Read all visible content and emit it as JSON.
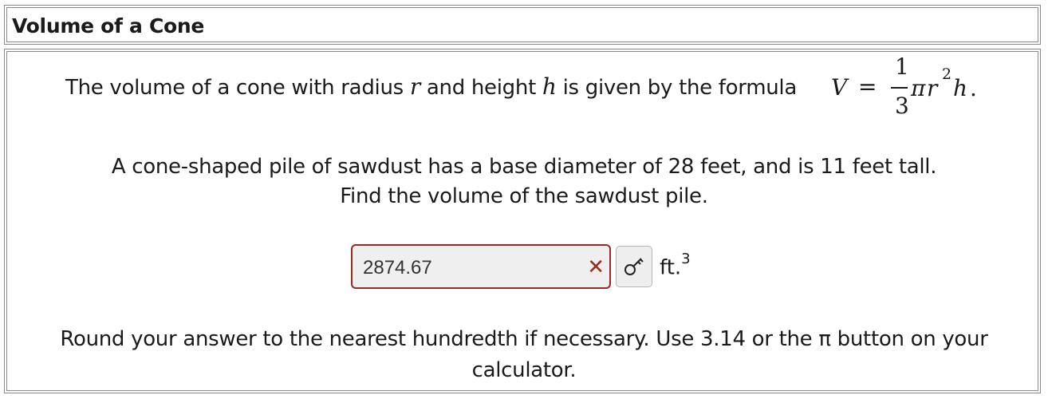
{
  "title": "Volume of a Cone",
  "problem": {
    "formula_intro": {
      "part1": "The volume of a cone with radius ",
      "var_r": "r",
      "part2": " and height ",
      "var_h": "h",
      "part3": " is given by the formula "
    },
    "formula": {
      "lhs": "V",
      "equals": "=",
      "numerator": "1",
      "denominator": "3",
      "pi": "π",
      "r": "r",
      "exponent": "2",
      "h": "h",
      "period": "."
    },
    "question_line1": "A cone-shaped pile of sawdust has a base diameter of 28 feet, and is 11 feet tall.",
    "question_line2": "Find the volume of the sawdust pile."
  },
  "answer": {
    "value": "2874.67",
    "status": "incorrect",
    "status_icon": "x-mark-icon",
    "status_color": "#9b2b20",
    "unit": "ft.",
    "unit_exponent": "3",
    "key_button_icon": "key-icon"
  },
  "instructions": {
    "line1": "Round your answer to the nearest hundredth if necessary. Use 3.14 or the π button on your",
    "line2": "calculator."
  }
}
